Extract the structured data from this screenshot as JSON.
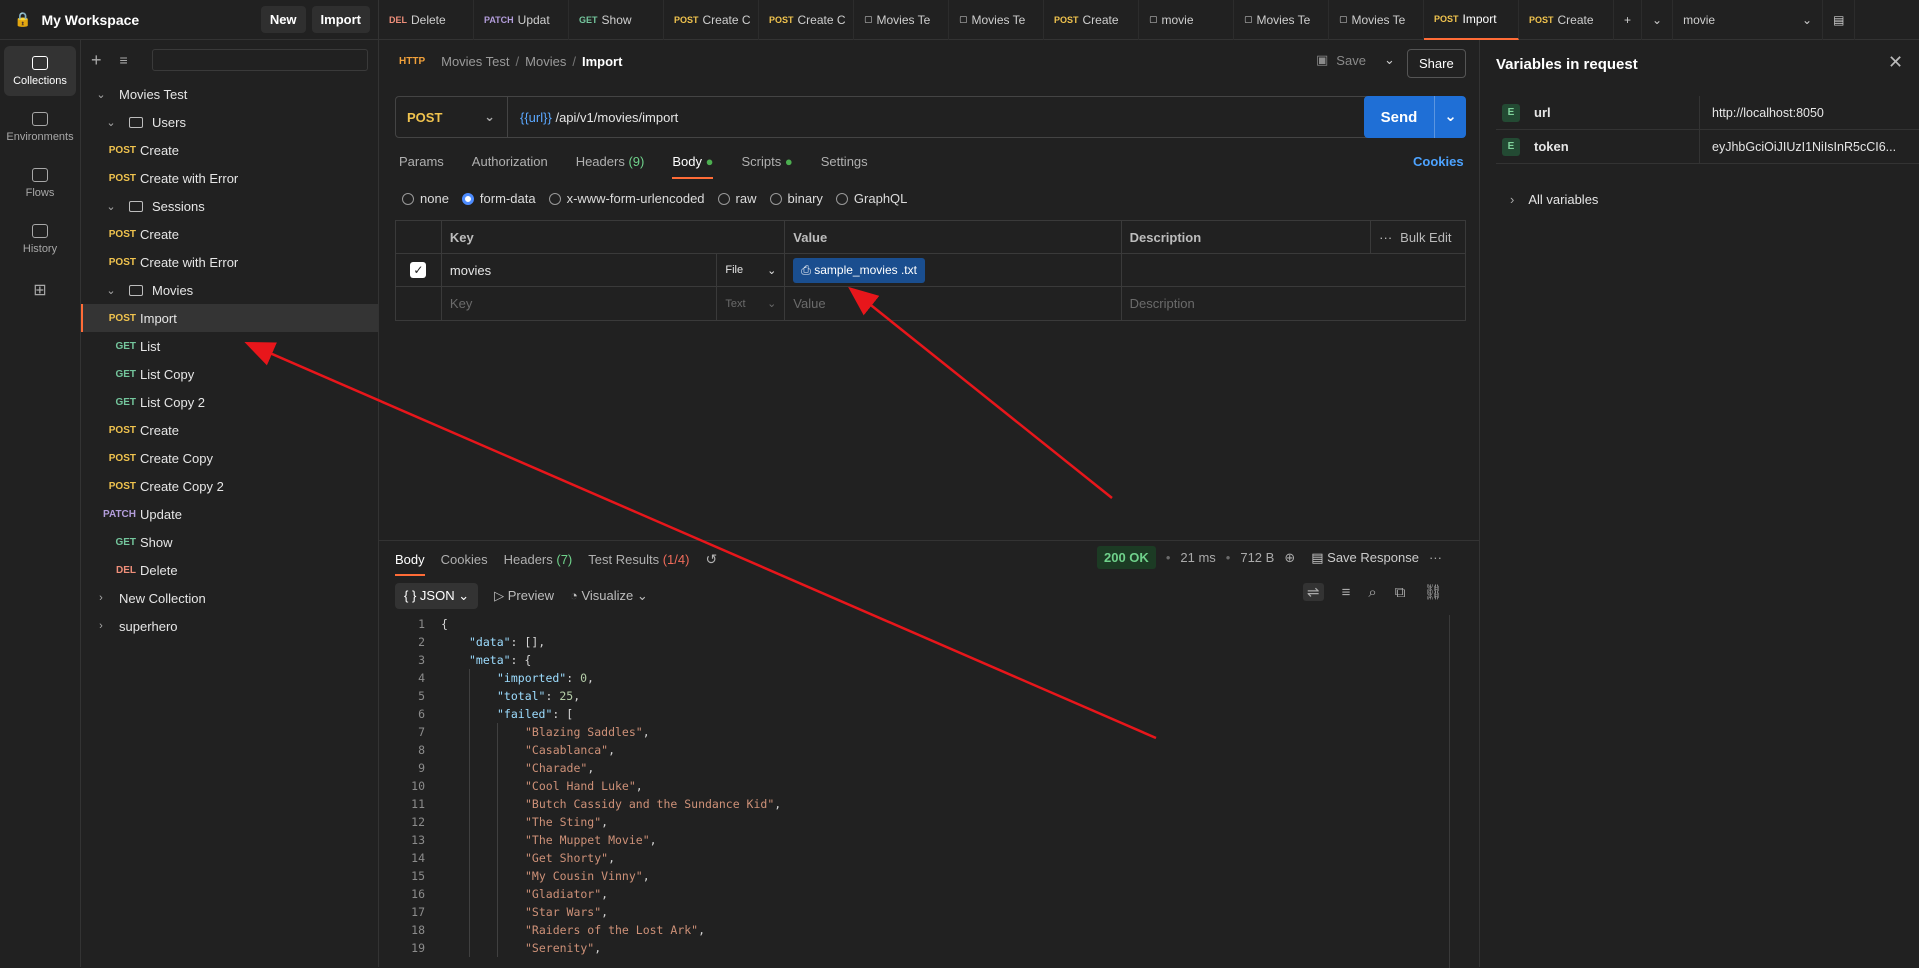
{
  "workspace": {
    "title": "My Workspace",
    "new_label": "New",
    "import_label": "Import"
  },
  "rail": [
    {
      "label": "Collections",
      "icon": "collections-icon",
      "active": true
    },
    {
      "label": "Environments",
      "icon": "environments-icon",
      "active": false
    },
    {
      "label": "Flows",
      "icon": "flows-icon",
      "active": false
    },
    {
      "label": "History",
      "icon": "history-icon",
      "active": false
    }
  ],
  "tree": [
    {
      "label": "Movies Test",
      "type": "collection",
      "expanded": true,
      "indent": 0
    },
    {
      "label": "Users",
      "type": "folder",
      "expanded": true,
      "indent": 1
    },
    {
      "label": "Create",
      "type": "request",
      "method": "POST",
      "indent": 2
    },
    {
      "label": "Create with Error",
      "type": "request",
      "method": "POST",
      "indent": 2
    },
    {
      "label": "Sessions",
      "type": "folder",
      "expanded": true,
      "indent": 1
    },
    {
      "label": "Create",
      "type": "request",
      "method": "POST",
      "indent": 2
    },
    {
      "label": "Create with Error",
      "type": "request",
      "method": "POST",
      "indent": 2
    },
    {
      "label": "Movies",
      "type": "folder",
      "expanded": true,
      "indent": 1
    },
    {
      "label": "Import",
      "type": "request",
      "method": "POST",
      "indent": 2,
      "active": true
    },
    {
      "label": "List",
      "type": "request",
      "method": "GET",
      "indent": 2
    },
    {
      "label": "List Copy",
      "type": "request",
      "method": "GET",
      "indent": 2
    },
    {
      "label": "List Copy 2",
      "type": "request",
      "method": "GET",
      "indent": 2
    },
    {
      "label": "Create",
      "type": "request",
      "method": "POST",
      "indent": 2
    },
    {
      "label": "Create Copy",
      "type": "request",
      "method": "POST",
      "indent": 2
    },
    {
      "label": "Create Copy 2",
      "type": "request",
      "method": "POST",
      "indent": 2
    },
    {
      "label": "Update",
      "type": "request",
      "method": "PATCH",
      "indent": 2
    },
    {
      "label": "Show",
      "type": "request",
      "method": "GET",
      "indent": 2
    },
    {
      "label": "Delete",
      "type": "request",
      "method": "DEL",
      "indent": 2
    },
    {
      "label": "New Collection",
      "type": "collection",
      "expanded": false,
      "indent": 0
    },
    {
      "label": "superhero",
      "type": "collection",
      "expanded": false,
      "indent": 0
    }
  ],
  "tabs": [
    {
      "method": "DEL",
      "label": "Delete"
    },
    {
      "method": "PATCH",
      "label": "Updat"
    },
    {
      "method": "GET",
      "label": "Show"
    },
    {
      "method": "POST",
      "label": "Create C"
    },
    {
      "method": "POST",
      "label": "Create C"
    },
    {
      "method": "",
      "label": "Movies Te",
      "icon": "collection-icon"
    },
    {
      "method": "",
      "label": "Movies Te",
      "icon": "doc-icon"
    },
    {
      "method": "POST",
      "label": "Create"
    },
    {
      "method": "",
      "label": "movie",
      "icon": "env-icon"
    },
    {
      "method": "",
      "label": "Movies Te",
      "icon": "run-icon"
    },
    {
      "method": "",
      "label": "Movies Te",
      "icon": "run-icon"
    },
    {
      "method": "POST",
      "label": "Import",
      "active": true
    },
    {
      "method": "POST",
      "label": "Create"
    }
  ],
  "env_select": "movie",
  "request": {
    "breadcrumb": [
      "Movies Test",
      "Movies",
      "Import"
    ],
    "save_label": "Save",
    "share_label": "Share",
    "method": "POST",
    "url_var": "{{url}}",
    "url_path": "/api/v1/movies/import",
    "send_label": "Send",
    "tabs": [
      "Params",
      "Authorization",
      "Headers",
      "Body",
      "Scripts",
      "Settings"
    ],
    "headers_count": "(9)",
    "cookies_label": "Cookies",
    "body_types": [
      "none",
      "form-data",
      "x-www-form-urlencoded",
      "raw",
      "binary",
      "GraphQL"
    ],
    "selected_body_type": "form-data",
    "kv_headers": {
      "key": "Key",
      "value": "Value",
      "description": "Description",
      "bulk_edit": "Bulk Edit"
    },
    "kv_row": {
      "key": "movies",
      "type": "File",
      "file": "sample_movies .txt"
    },
    "kv_empty": {
      "key": "Key",
      "type": "Text",
      "value": "Value",
      "description": "Description"
    }
  },
  "response": {
    "tabs": {
      "body": "Body",
      "cookies": "Cookies",
      "headers": "Headers",
      "headers_count": "(7)",
      "tests": "Test Results",
      "tests_count": "(1/4)"
    },
    "status": "200 OK",
    "time": "21 ms",
    "size": "712 B",
    "save_label": "Save Response",
    "format": "JSON",
    "preview_label": "Preview",
    "visualize_label": "Visualize",
    "lines": [
      {
        "n": "1",
        "depth": 0,
        "text": "{",
        "kind": "p"
      },
      {
        "n": "2",
        "depth": 1,
        "key": "\"data\"",
        "rest": ": [],",
        "kind": "kv"
      },
      {
        "n": "3",
        "depth": 1,
        "key": "\"meta\"",
        "rest": ": {",
        "kind": "kv"
      },
      {
        "n": "4",
        "depth": 2,
        "key": "\"imported\"",
        "rest": ": ",
        "num": "0",
        "tail": ",",
        "kind": "kn"
      },
      {
        "n": "5",
        "depth": 2,
        "key": "\"total\"",
        "rest": ": ",
        "num": "25",
        "tail": ",",
        "kind": "kn"
      },
      {
        "n": "6",
        "depth": 2,
        "key": "\"failed\"",
        "rest": ": [",
        "kind": "kv"
      },
      {
        "n": "7",
        "depth": 3,
        "str": "\"Blazing Saddles\"",
        "kind": "s"
      },
      {
        "n": "8",
        "depth": 3,
        "str": "\"Casablanca\"",
        "kind": "s"
      },
      {
        "n": "9",
        "depth": 3,
        "str": "\"Charade\"",
        "kind": "s"
      },
      {
        "n": "10",
        "depth": 3,
        "str": "\"Cool Hand Luke\"",
        "kind": "s"
      },
      {
        "n": "11",
        "depth": 3,
        "str": "\"Butch Cassidy and the Sundance Kid\"",
        "kind": "s"
      },
      {
        "n": "12",
        "depth": 3,
        "str": "\"The Sting\"",
        "kind": "s"
      },
      {
        "n": "13",
        "depth": 3,
        "str": "\"The Muppet Movie\"",
        "kind": "s"
      },
      {
        "n": "14",
        "depth": 3,
        "str": "\"Get Shorty\"",
        "kind": "s"
      },
      {
        "n": "15",
        "depth": 3,
        "str": "\"My Cousin Vinny\"",
        "kind": "s"
      },
      {
        "n": "16",
        "depth": 3,
        "str": "\"Gladiator\"",
        "kind": "s"
      },
      {
        "n": "17",
        "depth": 3,
        "str": "\"Star Wars\"",
        "kind": "s"
      },
      {
        "n": "18",
        "depth": 3,
        "str": "\"Raiders of the Lost Ark\"",
        "kind": "s"
      },
      {
        "n": "19",
        "depth": 3,
        "str": "\"Serenity\"",
        "kind": "s"
      }
    ]
  },
  "variables": {
    "title": "Variables in request",
    "rows": [
      {
        "badge": "E",
        "name": "url",
        "value": "http://localhost:8050"
      },
      {
        "badge": "E",
        "name": "token",
        "value": "eyJhbGciOiJIUzI1NiIsInR5cCI6..."
      }
    ],
    "all_label": "All variables"
  },
  "colors": {
    "accent": "#ff6c37",
    "send": "#1f6fd6",
    "arrow": "#e8161b"
  }
}
